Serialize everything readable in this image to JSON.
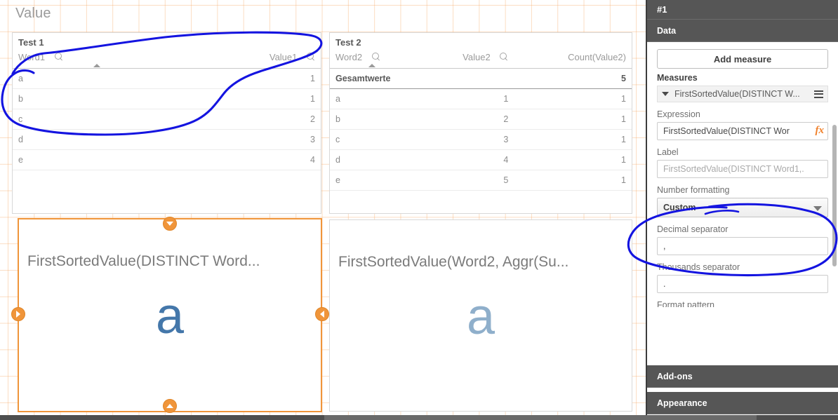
{
  "sheet": {
    "title": "Value"
  },
  "tables": [
    {
      "title": "Test 1",
      "columns": [
        {
          "label": "Word1",
          "align": "left",
          "search": true,
          "sorted": true
        },
        {
          "label": "Value1",
          "align": "right",
          "search": true,
          "sorted": false
        }
      ],
      "total_row": null,
      "rows": [
        [
          "a",
          "1"
        ],
        [
          "b",
          "1"
        ],
        [
          "c",
          "2"
        ],
        [
          "d",
          "3"
        ],
        [
          "e",
          "4"
        ]
      ]
    },
    {
      "title": "Test 2",
      "columns": [
        {
          "label": "Word2",
          "align": "left",
          "search": true,
          "sorted": true
        },
        {
          "label": "Value2",
          "align": "right",
          "search": true,
          "sorted": false
        },
        {
          "label": "Count(Value2)",
          "align": "right",
          "search": false,
          "sorted": false
        }
      ],
      "total_row": [
        "Gesamtwerte",
        "",
        "5"
      ],
      "rows": [
        [
          "a",
          "1",
          "1"
        ],
        [
          "b",
          "2",
          "1"
        ],
        [
          "c",
          "3",
          "1"
        ],
        [
          "d",
          "4",
          "1"
        ],
        [
          "e",
          "5",
          "1"
        ]
      ]
    }
  ],
  "kpis": [
    {
      "label": "FirstSortedValue(DISTINCT Word...",
      "value": "a",
      "selected": true
    },
    {
      "label": "FirstSortedValue(Word2, Aggr(Su...",
      "value": "a",
      "selected": false
    }
  ],
  "panel": {
    "header": "#1",
    "sections": {
      "data": "Data",
      "addons": "Add-ons",
      "appearance": "Appearance"
    },
    "add_measure_label": "Add measure",
    "measures_group_label": "Measures",
    "measure_item": "FirstSortedValue(DISTINCT W...",
    "fields": {
      "expression_label": "Expression",
      "expression_value": "FirstSortedValue(DISTINCT Wor",
      "expression_fx": "fx",
      "label_label": "Label",
      "label_placeholder": "FirstSortedValue(DISTINCT Word1,.",
      "number_formatting_label": "Number formatting",
      "number_formatting_value": "Custom",
      "decimal_separator_label": "Decimal separator",
      "decimal_separator_value": ",",
      "thousands_separator_label": "Thousands separator",
      "thousands_separator_value": ".",
      "format_pattern_label": "Format pattern"
    }
  },
  "colors": {
    "accent_orange": "#f0953a",
    "grid_orange": "#f5a661",
    "panel_dark": "#565656",
    "kpi_blue": "#4477aa",
    "kpi_blue_muted": "#8fafcb",
    "annotation_blue": "#1414e0"
  }
}
